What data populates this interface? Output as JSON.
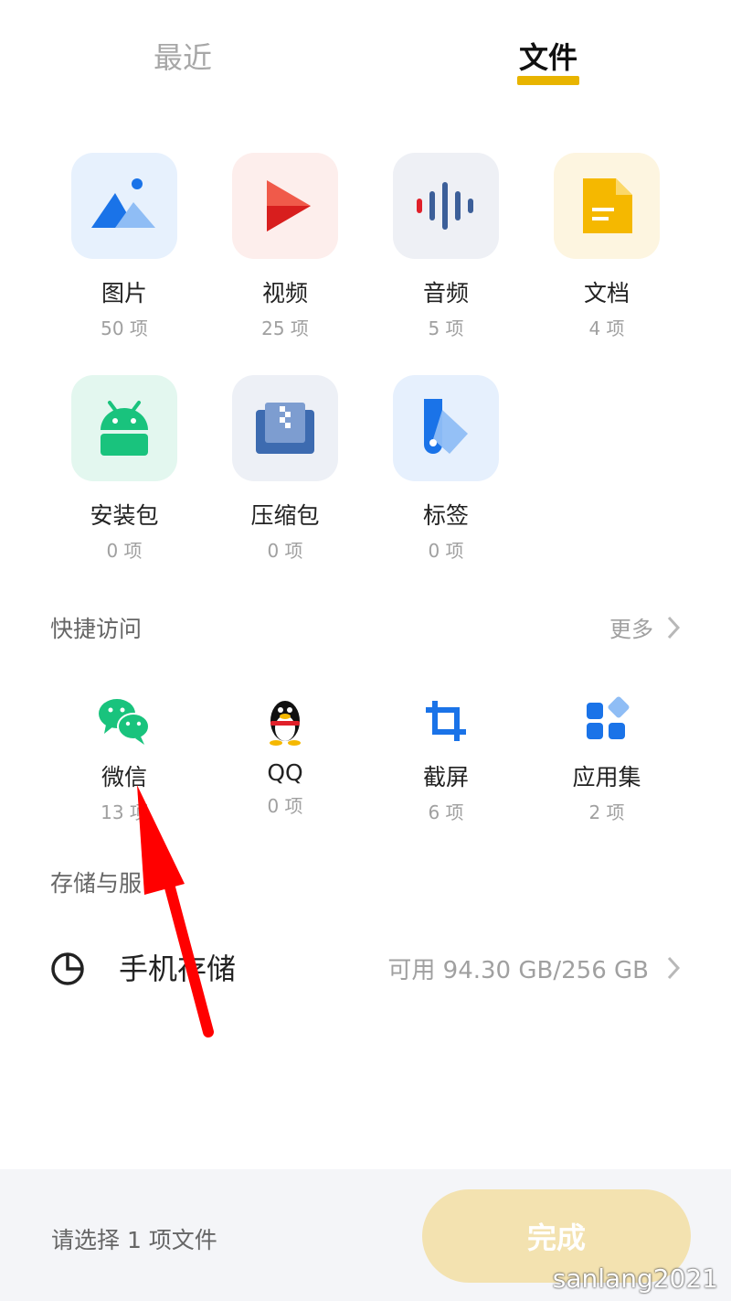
{
  "tabs": {
    "recent": "最近",
    "files": "文件"
  },
  "categories": [
    {
      "name": "图片",
      "count": "50 项"
    },
    {
      "name": "视频",
      "count": "25 项"
    },
    {
      "name": "音频",
      "count": "5 项"
    },
    {
      "name": "文档",
      "count": "4 项"
    },
    {
      "name": "安装包",
      "count": "0 项"
    },
    {
      "name": "压缩包",
      "count": "0 项"
    },
    {
      "name": "标签",
      "count": "0 项"
    }
  ],
  "quick_access": {
    "title": "快捷访问",
    "more": "更多",
    "items": [
      {
        "name": "微信",
        "count": "13 项"
      },
      {
        "name": "QQ",
        "count": "0 项"
      },
      {
        "name": "截屏",
        "count": "6 项"
      },
      {
        "name": "应用集",
        "count": "2 项"
      }
    ]
  },
  "storage": {
    "title": "存储与服",
    "phone_label": "手机存储",
    "phone_value": "可用 94.30 GB/256 GB"
  },
  "bottom": {
    "hint": "请选择 1 项文件",
    "done": "完成"
  },
  "watermark": "sanlang2021",
  "colors": {
    "accent": "#e8b400",
    "done_disabled": "#f3e2b0",
    "annotation_arrow": "#ff0000"
  }
}
